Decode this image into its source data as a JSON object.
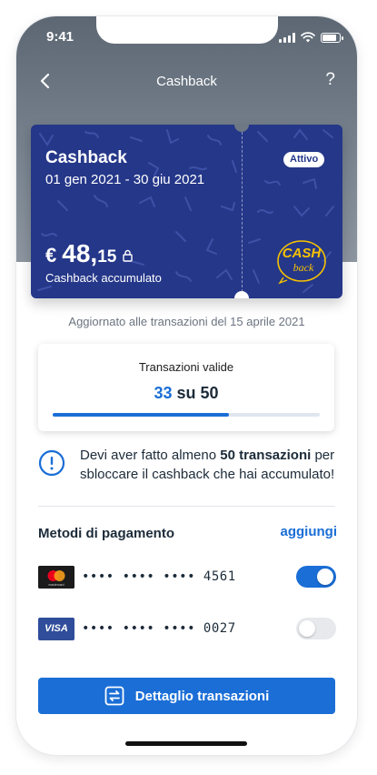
{
  "status_bar": {
    "time": "9:41"
  },
  "navbar": {
    "title": "Cashback",
    "help": "?"
  },
  "card": {
    "title": "Cashback",
    "period": "01 gen 2021 - 30 giu 2021",
    "status": "Attivo",
    "amount_currency": "€",
    "amount_int": "48,",
    "amount_dec": "15",
    "amount_label": "Cashback accumulato",
    "logo_top": "CASH",
    "logo_bottom": "back",
    "bg_color": "#253789"
  },
  "update_note": "Aggiornato alle transazioni del 15 aprile 2021",
  "transactions": {
    "label": "Transazioni valide",
    "current": "33",
    "separator": "su",
    "total": "50",
    "progress": 0.66
  },
  "info": {
    "text_pre": "Devi aver fatto almeno ",
    "text_bold": "50 transazioni",
    "text_post": " per sbloccare il cashback che hai accumulato!"
  },
  "payment_methods": {
    "title": "Metodi di pagamento",
    "add_label": "aggiungi",
    "items": [
      {
        "brand": "mastercard",
        "number": "•••• •••• •••• 4561",
        "enabled": true
      },
      {
        "brand": "VISA",
        "number": "•••• •••• •••• 0027",
        "enabled": false
      }
    ]
  },
  "detail_button": {
    "label": "Dettaglio transazioni"
  },
  "colors": {
    "accent": "#1a6ed6",
    "card": "#253789",
    "header": "#6e7884"
  }
}
